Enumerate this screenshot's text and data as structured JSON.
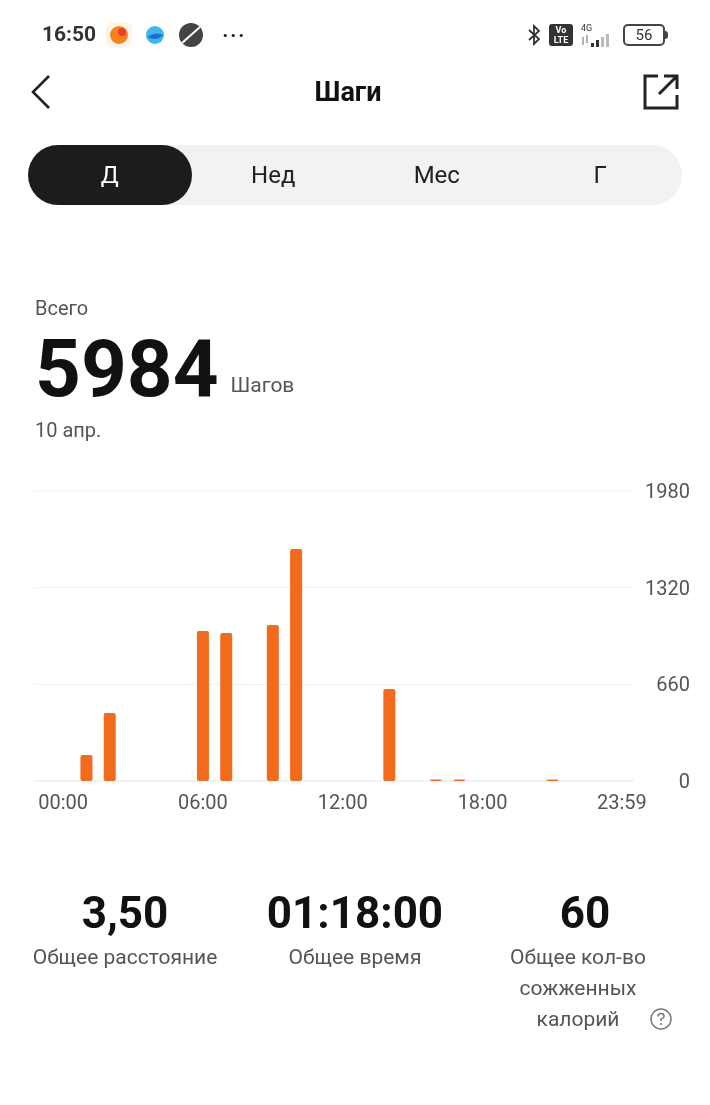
{
  "status_bar": {
    "time": "16:50",
    "more": "···",
    "lte": "Vo LTE",
    "network": "4G",
    "battery": "56"
  },
  "header": {
    "title": "Шаги"
  },
  "tabs": [
    {
      "label": "Д",
      "selected": true
    },
    {
      "label": "Нед",
      "selected": false
    },
    {
      "label": "Мес",
      "selected": false
    },
    {
      "label": "Г",
      "selected": false
    }
  ],
  "summary": {
    "label": "Всего",
    "value": "5984",
    "unit": "Шагов",
    "date": "10 апр."
  },
  "chart_data": {
    "type": "bar",
    "x": [
      0,
      1,
      2,
      3,
      4,
      5,
      6,
      7,
      8,
      9,
      10,
      11,
      12,
      13,
      14,
      15,
      16,
      17,
      18,
      19,
      20,
      21,
      22,
      23
    ],
    "series": [
      {
        "color": "#f26b1d",
        "values": [
          0,
          178,
          464,
          0,
          0,
          0,
          1024,
          1010,
          0,
          1065,
          1584,
          0,
          0,
          0,
          628,
          0,
          10,
          10,
          0,
          0,
          0,
          11,
          0,
          0
        ]
      }
    ],
    "xlim": [
      -1.25,
      24.5
    ],
    "ylim": [
      0,
      1980
    ],
    "yticks": [
      0,
      660,
      1320,
      1980
    ],
    "xticks": [
      {
        "value": 0,
        "label": "00:00"
      },
      {
        "value": 6,
        "label": "06:00"
      },
      {
        "value": 12,
        "label": "12:00"
      },
      {
        "value": 18,
        "label": "18:00"
      },
      {
        "value": 23.983,
        "label": "23:59"
      }
    ]
  },
  "stats": [
    {
      "value": "3,50",
      "label": "Общее расстояние",
      "help": false
    },
    {
      "value": "01:18:00",
      "label": "Общее время",
      "help": false
    },
    {
      "value": "60",
      "label": "Общее кол-во сожженных калорий",
      "help": true
    }
  ]
}
